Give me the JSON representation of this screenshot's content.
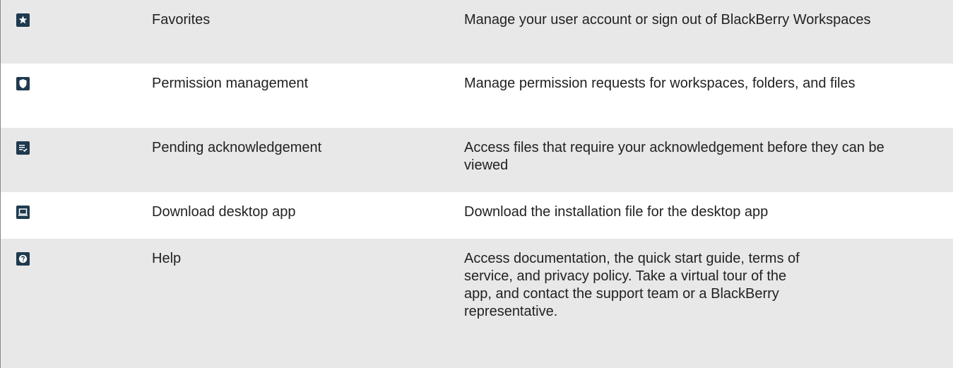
{
  "rows": [
    {
      "icon": "star-icon",
      "name": "Favorites",
      "description": "Manage your user account or sign out of BlackBerry Workspaces"
    },
    {
      "icon": "shield-icon",
      "name": "Permission management",
      "description": "Manage permission requests for workspaces, folders, and files"
    },
    {
      "icon": "checklist-icon",
      "name": "Pending acknowledgement",
      "description": "Access files that require your acknowledgement before they can be viewed"
    },
    {
      "icon": "laptop-icon",
      "name": "Download desktop app",
      "description": "Download the installation file for the desktop app"
    },
    {
      "icon": "help-icon",
      "name": "Help",
      "description": "Access documentation, the quick start guide, terms of service, and privacy policy. Take a virtual tour of the app, and contact the support team or a BlackBerry representative."
    }
  ],
  "colors": {
    "shaded_row": "#e8e8e8",
    "plain_row": "#ffffff",
    "icon_background": "#1f3a4f",
    "text": "#222222"
  }
}
